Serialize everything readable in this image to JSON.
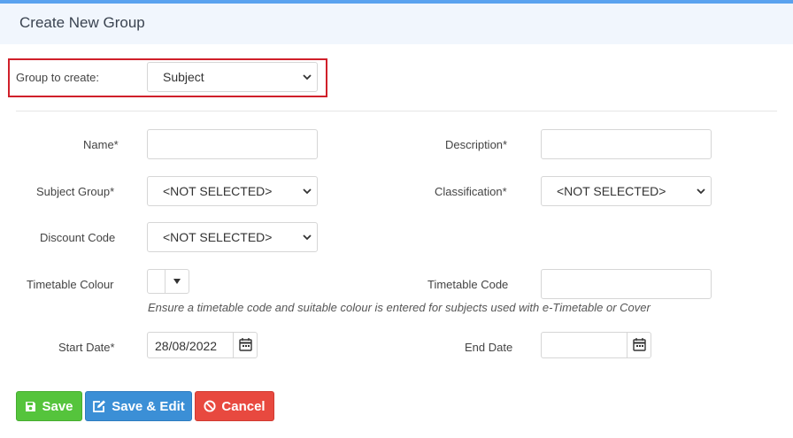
{
  "header": {
    "title": "Create New Group"
  },
  "group_to_create": {
    "label": "Group to create:",
    "value": "Subject"
  },
  "fields": {
    "name_label": "Name*",
    "description_label": "Description*",
    "subject_group": {
      "label": "Subject Group*",
      "value": "<NOT SELECTED>"
    },
    "classification": {
      "label": "Classification*",
      "value": "<NOT SELECTED>"
    },
    "discount_code": {
      "label": "Discount Code",
      "value": "<NOT SELECTED>"
    },
    "timetable_colour_label": "Timetable Colour",
    "timetable_code_label": "Timetable Code",
    "hint": "Ensure a timetable code and suitable colour is entered for subjects used with e-Timetable or Cover",
    "start_date": {
      "label": "Start Date*",
      "value": "28/08/2022"
    },
    "end_date": {
      "label": "End Date",
      "value": ""
    }
  },
  "buttons": {
    "save": "Save",
    "save_edit": "Save & Edit",
    "cancel": "Cancel"
  },
  "colors": {
    "accent": "#5aa2ef",
    "save": "#55c43c",
    "save_edit": "#3b8fd6",
    "cancel": "#e8493f",
    "highlight": "#d0202a"
  },
  "icons": {
    "save": "floppy-icon",
    "save_edit": "edit-icon",
    "cancel": "ban-icon",
    "calendar": "calendar-icon",
    "chevron": "chevron-down-icon"
  }
}
